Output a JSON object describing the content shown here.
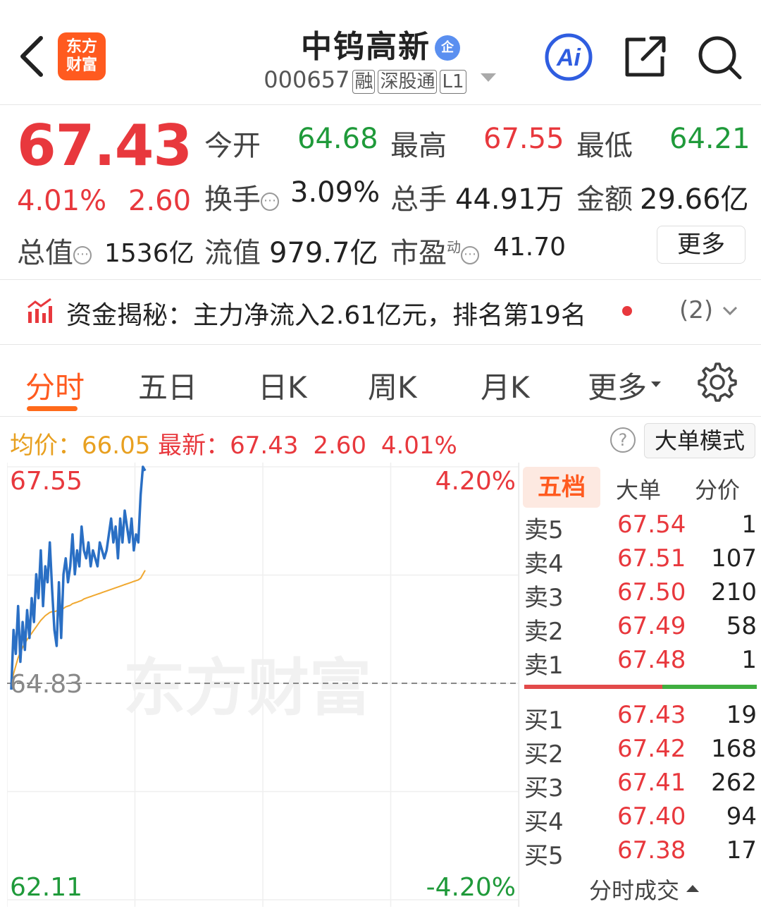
{
  "header": {
    "back_icon": "chevron-left-icon",
    "logo_line1": "东方",
    "logo_line2": "财富",
    "stock_name": "中钨高新",
    "badge": "企",
    "stock_code": "000657",
    "tags": [
      "融",
      "深股通",
      "L1"
    ],
    "ai_label": "Ai"
  },
  "quote": {
    "price": "67.43",
    "change_pct": "4.01%",
    "change_amt": "2.60",
    "rows": [
      [
        {
          "label": "今开",
          "value": "64.68",
          "color": "green"
        },
        {
          "label": "最高",
          "value": "67.55",
          "color": "red"
        },
        {
          "label": "最低",
          "value": "64.21",
          "color": "green"
        }
      ],
      [
        {
          "label": "换手",
          "value": "3.09%",
          "info": true
        },
        {
          "label": "总手",
          "value": "44.91万"
        },
        {
          "label": "金额",
          "value": "29.66亿"
        }
      ]
    ],
    "total_value_label": "总值",
    "total_value": "1536亿",
    "float_value_label": "流值",
    "float_value": "979.7亿",
    "pe_label": "市盈",
    "pe_sup": "动",
    "pe_value": "41.70",
    "more_button": "更多"
  },
  "fund_flow": {
    "text": "资金揭秘：主力净流入2.61亿元，排名第19名",
    "count": "(2)"
  },
  "tabs": [
    "分时",
    "五日",
    "日K",
    "周K",
    "月K",
    "更多"
  ],
  "summary": {
    "avg_label": "均价：",
    "avg_value": "66.05",
    "latest_label": "最新：",
    "latest_value": "67.43",
    "change_amt": "2.60",
    "change_pct": "4.01%",
    "help": "?",
    "mode_button": "大单模式"
  },
  "chart_data": {
    "type": "line",
    "y_top_label": "67.55",
    "y_mid_label": "64.83",
    "y_bottom_label": "62.11",
    "pct_top_label": "4.20%",
    "pct_bottom_label": "-4.20%",
    "ylim": [
      62.11,
      67.55
    ],
    "prev_close": 64.83,
    "watermark": "东方财富",
    "colors": {
      "price": "#2a6fc4",
      "avg": "#f0a830",
      "axis_red": "#e8383d",
      "axis_green": "#1f9a3a"
    },
    "series": [
      {
        "name": "",
        "x": [
          0,
          1,
          2,
          3,
          4,
          5,
          6,
          7,
          8,
          9,
          10,
          11,
          12,
          13,
          14,
          15,
          16,
          17,
          18,
          19,
          20,
          21,
          22,
          23,
          24,
          25,
          26,
          27,
          28,
          29,
          30,
          31,
          32,
          33,
          34,
          35,
          36,
          37,
          38,
          39,
          40,
          41,
          42,
          43,
          44,
          45,
          46,
          47,
          48,
          49,
          50,
          51,
          52,
          53,
          54,
          55,
          56,
          57,
          58,
          59
        ],
        "values": [
          64.75,
          65.5,
          65.2,
          65.8,
          65.1,
          65.6,
          65.25,
          65.75,
          65.4,
          65.9,
          65.6,
          66.2,
          65.9,
          66.5,
          65.8,
          66.3,
          66.1,
          66.6,
          66.0,
          65.5,
          65.3,
          66.1,
          65.4,
          66.2,
          66.4,
          66.1,
          66.3,
          66.7,
          66.2,
          66.5,
          66.3,
          66.8,
          66.5,
          66.4,
          66.6,
          66.3,
          66.5,
          66.4,
          66.3,
          66.6,
          66.5,
          66.4,
          66.5,
          66.7,
          66.9,
          66.6,
          66.8,
          66.4,
          66.9,
          66.6,
          67.0,
          66.8,
          66.6,
          66.9,
          66.5,
          66.7,
          66.6,
          67.2,
          67.55,
          67.5
        ]
      },
      {
        "name": "",
        "x": [
          0,
          1,
          2,
          3,
          4,
          5,
          6,
          7,
          8,
          9,
          10,
          11,
          12,
          13,
          14,
          15,
          16,
          17,
          18,
          19,
          20,
          21,
          22,
          23,
          24,
          25,
          26,
          27,
          28,
          29,
          30,
          31,
          32,
          33,
          34,
          35,
          36,
          37,
          38,
          39,
          40,
          41,
          42,
          43,
          44,
          45,
          46,
          47,
          48,
          49,
          50,
          51,
          52,
          53,
          54,
          55,
          56,
          57,
          58,
          59
        ],
        "values": [
          64.8,
          64.95,
          65.05,
          65.15,
          65.22,
          65.28,
          65.33,
          65.38,
          65.42,
          65.46,
          65.5,
          65.54,
          65.58,
          65.62,
          65.65,
          65.68,
          65.7,
          65.72,
          65.73,
          65.73,
          65.74,
          65.75,
          65.76,
          65.77,
          65.79,
          65.8,
          65.81,
          65.83,
          65.84,
          65.85,
          65.86,
          65.87,
          65.89,
          65.9,
          65.91,
          65.92,
          65.93,
          65.94,
          65.95,
          65.96,
          65.97,
          65.98,
          65.99,
          66.0,
          66.01,
          66.02,
          66.03,
          66.04,
          66.05,
          66.06,
          66.07,
          66.08,
          66.09,
          66.1,
          66.11,
          66.12,
          66.13,
          66.15,
          66.2,
          66.25
        ]
      }
    ]
  },
  "order_book": {
    "tabs": [
      "五档",
      "大单",
      "分价"
    ],
    "asks": [
      {
        "label": "卖5",
        "price": "67.54",
        "vol": "1"
      },
      {
        "label": "卖4",
        "price": "67.51",
        "vol": "107"
      },
      {
        "label": "卖3",
        "price": "67.50",
        "vol": "210"
      },
      {
        "label": "卖2",
        "price": "67.49",
        "vol": "58"
      },
      {
        "label": "卖1",
        "price": "67.48",
        "vol": "1"
      }
    ],
    "bids": [
      {
        "label": "买1",
        "price": "67.43",
        "vol": "19"
      },
      {
        "label": "买2",
        "price": "67.42",
        "vol": "168"
      },
      {
        "label": "买3",
        "price": "67.41",
        "vol": "262"
      },
      {
        "label": "买4",
        "price": "67.40",
        "vol": "94"
      },
      {
        "label": "买5",
        "price": "67.38",
        "vol": "17"
      }
    ],
    "footer": "分时成交"
  }
}
